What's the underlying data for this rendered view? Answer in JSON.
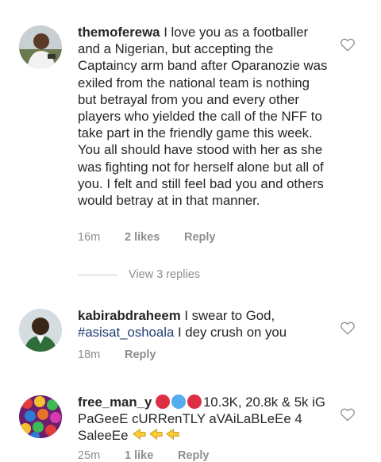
{
  "comments": [
    {
      "username": "themoferewa",
      "text": "I love you as a footballer and a Nigerian, but accepting the Captaincy arm band after Oparanozie was exiled from the national team is nothing but betrayal from you and every other players who yielded the call of the NFF to take part in the friendly game this week. You all should have stood with her as she was fighting not for herself alone but all of you. I felt and still feel bad you and others would betray at in that manner.",
      "time": "16m",
      "likes": "2 likes",
      "reply": "Reply",
      "view_replies": "View 3 replies"
    },
    {
      "username": "kabirabdraheem",
      "text_before": "I swear to God,",
      "mention": "#asisat_oshoala",
      "text_after": "I dey crush on you",
      "time": "18m",
      "reply": "Reply"
    },
    {
      "username": "free_man_y",
      "text": "10.3K, 20.8k & 5k iG  PaGeeE cURRenTLY  aVAiLaBLeEe 4 SaleeEe",
      "time": "25m",
      "likes": "1 like",
      "reply": "Reply"
    }
  ],
  "icons": {
    "like": "heart-outline-icon",
    "emoji_circles": [
      "red-circle",
      "blue-circle",
      "red-circle"
    ],
    "emoji_pointers": "backhand-index-pointing-right"
  },
  "colors": {
    "text": "#262626",
    "muted": "#8e8e8e",
    "mention": "#1f3f73"
  }
}
